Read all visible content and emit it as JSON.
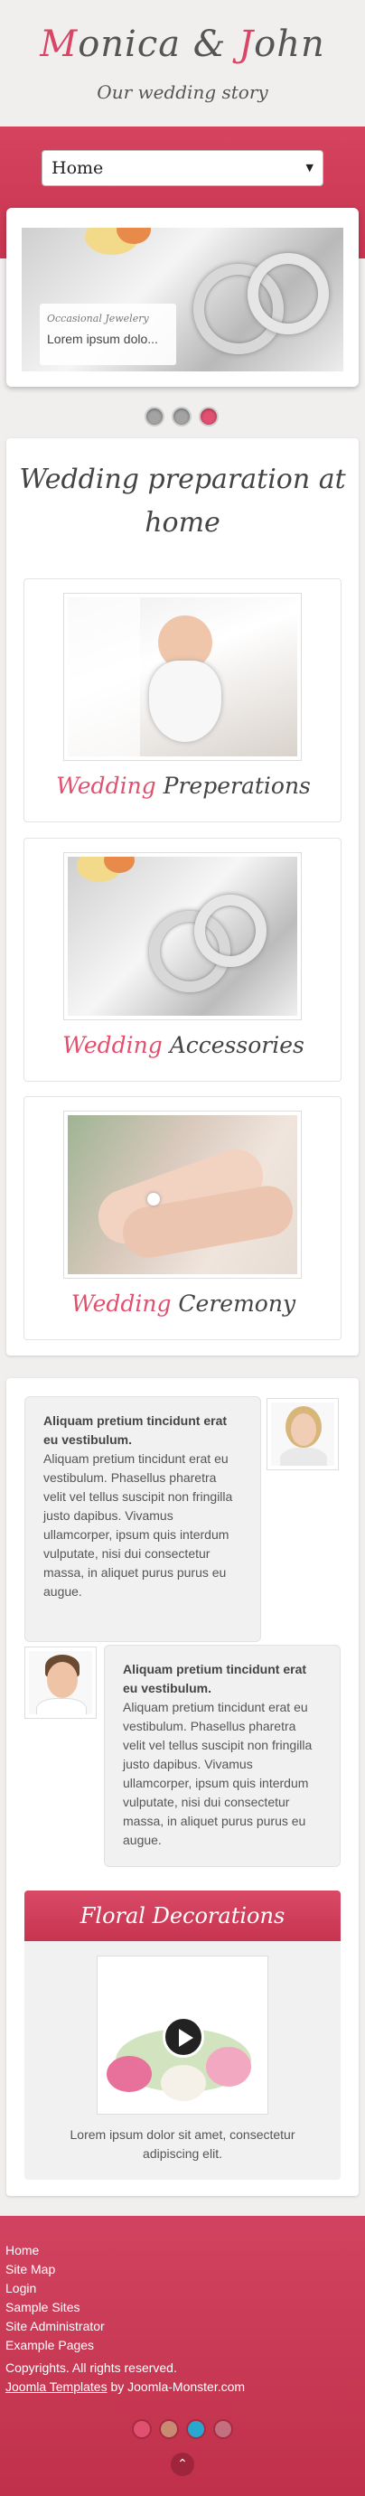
{
  "header": {
    "title_parts": [
      "M",
      "onica & ",
      "J",
      "ohn"
    ],
    "tagline": "Our wedding story"
  },
  "nav": {
    "selected": "Home"
  },
  "slider": {
    "caption_title": "Occasional Jewelery",
    "caption_text": "Lorem ipsum dolo...",
    "dots": 3,
    "active_dot": 3
  },
  "preparation": {
    "title_line1": "Wedding preparation at",
    "title_line2": "home",
    "cards": [
      {
        "accent": "Wedding",
        "word": "Preperations"
      },
      {
        "accent": "Wedding",
        "word": "Accessories"
      },
      {
        "accent": "Wedding",
        "word": "Ceremony"
      }
    ]
  },
  "testimonials": [
    {
      "heading": "Aliquam pretium tincidunt erat eu vestibulum.",
      "text": "Aliquam pretium tincidunt erat eu vestibulum. Phasellus pharetra velit vel tellus suscipit non fringilla justo dapibus. Vivamus ullamcorper, ipsum quis interdum vulputate, nisi dui consectetur massa, in aliquet purus purus eu augue."
    },
    {
      "heading": "Aliquam pretium tincidunt erat eu vestibulum.",
      "text": "Aliquam pretium tincidunt erat eu vestibulum. Phasellus pharetra velit vel tellus suscipit non fringilla justo dapibus. Vivamus ullamcorper, ipsum quis interdum vulputate, nisi dui consectetur massa, in aliquet purus purus eu augue."
    }
  ],
  "floral": {
    "title": "Floral Decorations",
    "text": "Lorem ipsum dolor sit amet, consectetur adipiscing elit."
  },
  "footer": {
    "links": [
      "Home",
      "Site Map",
      "Login",
      "Sample Sites",
      "Site Administrator",
      "Example Pages"
    ],
    "copyright": "Copyrights. All rights reserved.",
    "credit_link": "Joomla Templates",
    "credit_suffix": " by Joomla-Monster.com",
    "social_colors": [
      "#e0506f",
      "#c98a72",
      "#2aa7cf",
      "#c2707f"
    ]
  },
  "colors": {
    "accent": "#d94565",
    "band": "#c93550",
    "background": "#f1efee"
  }
}
